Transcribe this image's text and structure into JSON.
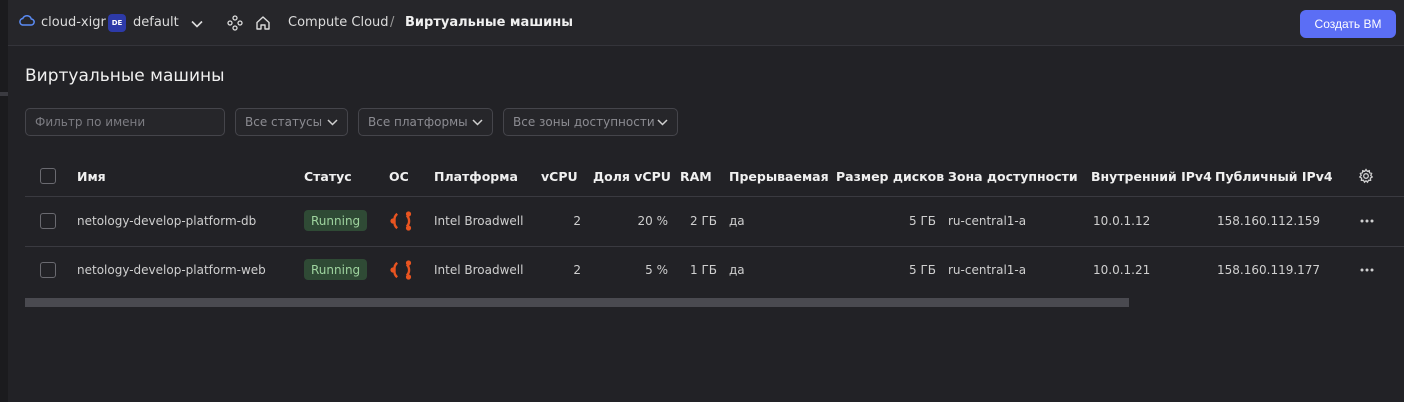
{
  "topbar": {
    "cloud_name": "cloud-xigr",
    "folder_badge": "DE",
    "folder_name": "default",
    "breadcrumbs": [
      "Compute Cloud",
      "Виртуальные машины"
    ],
    "breadcrumb_separator": "/",
    "create_button": "Создать ВМ"
  },
  "page": {
    "title": "Виртуальные машины",
    "filters": {
      "name_placeholder": "Фильтр по имени",
      "status": "Все статусы",
      "platform": "Все платформы",
      "zone": "Все зоны доступности"
    }
  },
  "table": {
    "columns": [
      "Имя",
      "Статус",
      "ОС",
      "Платформа",
      "vCPU",
      "Доля vCPU",
      "RAM",
      "Прерываемая",
      "Размер дисков",
      "Зона доступности",
      "Внутренний IPv4",
      "Публичный IPv4"
    ],
    "rows": [
      {
        "name": "netology-develop-platform-db",
        "status": "Running",
        "os": "ubuntu-icon",
        "platform": "Intel Broadwell",
        "vcpu": "2",
        "vcpu_share": "20 %",
        "ram": "2 ГБ",
        "preemptible": "да",
        "disk_size": "5 ГБ",
        "zone": "ru-central1-a",
        "internal_ip": "10.0.1.12",
        "public_ip": "158.160.112.159"
      },
      {
        "name": "netology-develop-platform-web",
        "status": "Running",
        "os": "ubuntu-icon",
        "platform": "Intel Broadwell",
        "vcpu": "2",
        "vcpu_share": "5 %",
        "ram": "1 ГБ",
        "preemptible": "да",
        "disk_size": "5 ГБ",
        "zone": "ru-central1-a",
        "internal_ip": "10.0.1.21",
        "public_ip": "158.160.119.177"
      }
    ]
  },
  "colors": {
    "accent": "#5b6ef5",
    "status_running_bg": "#2f4a35",
    "status_running_text": "#9fd49f",
    "ubuntu": "#e95420"
  }
}
